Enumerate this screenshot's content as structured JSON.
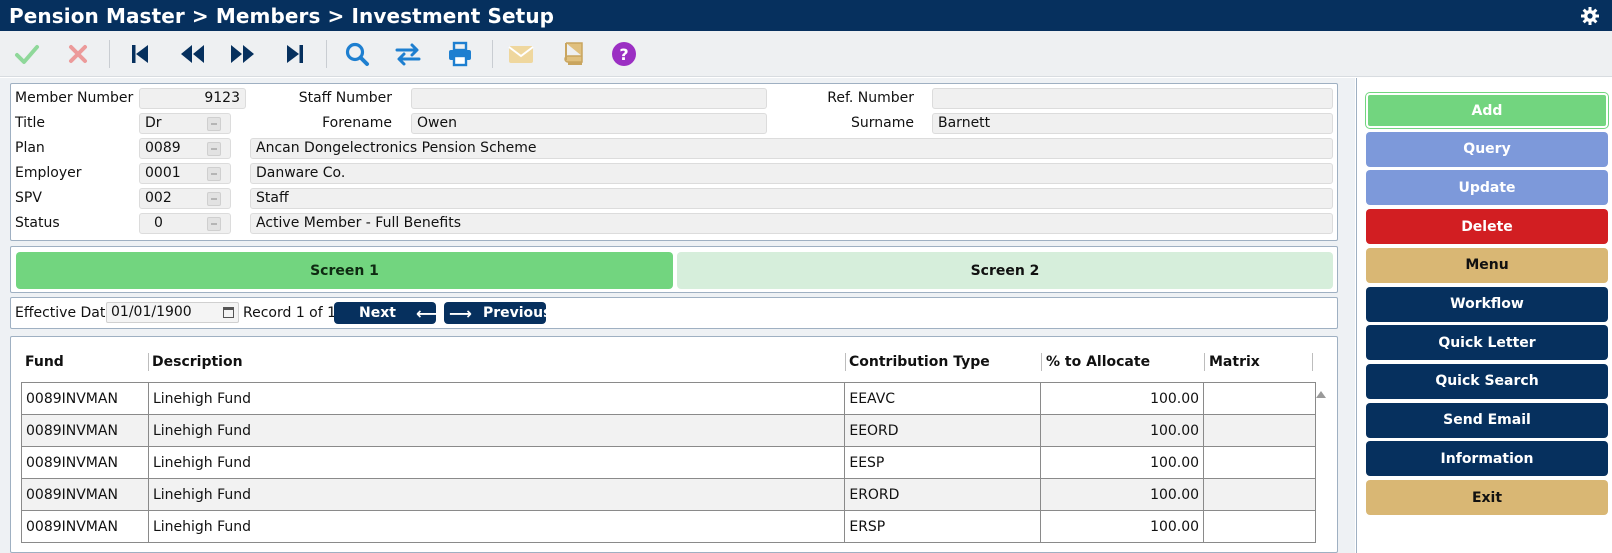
{
  "title": "Pension Master > Members > Investment Setup",
  "toolbar": {
    "icons": [
      "confirm-icon",
      "cancel-icon",
      "first-record-icon",
      "previous-record-icon",
      "next-record-icon",
      "last-record-icon",
      "search-icon",
      "swap-icon",
      "print-icon",
      "mail-icon",
      "book-icon",
      "help-icon"
    ]
  },
  "member": {
    "member_number_label": "Member Number",
    "member_number": "9123",
    "staff_number_label": "Staff Number",
    "staff_number": "",
    "ref_number_label": "Ref. Number",
    "ref_number": "",
    "title_label": "Title",
    "title": "Dr",
    "forename_label": "Forename",
    "forename": "Owen",
    "surname_label": "Surname",
    "surname": "Barnett",
    "plan_label": "Plan",
    "plan_code": "0089",
    "plan_name": "Ancan Dongelectronics Pension Scheme",
    "employer_label": "Employer",
    "employer_code": "0001",
    "employer_name": "Danware Co.",
    "spv_label": "SPV",
    "spv_code": "002",
    "spv_name": "Staff",
    "status_label": "Status",
    "status_code": "0",
    "status_name": "Active Member - Full Benefits"
  },
  "tabs": [
    "Screen 1",
    "Screen 2"
  ],
  "record_nav": {
    "effective_date_label": "Effective Date",
    "effective_date": "01/01/1900",
    "record_text": "Record 1 of 1",
    "next_label": "Next",
    "previous_label": "Previous"
  },
  "grid": {
    "headers": [
      "Fund",
      "Description",
      "Contribution Type",
      "% to Allocate",
      "Matrix"
    ],
    "rows": [
      {
        "fund": "0089INVMAN",
        "description": "Linehigh Fund",
        "type": "EEAVC",
        "pct": "100.00",
        "matrix": ""
      },
      {
        "fund": "0089INVMAN",
        "description": "Linehigh Fund",
        "type": "EEORD",
        "pct": "100.00",
        "matrix": ""
      },
      {
        "fund": "0089INVMAN",
        "description": "Linehigh Fund",
        "type": "EESP",
        "pct": "100.00",
        "matrix": ""
      },
      {
        "fund": "0089INVMAN",
        "description": "Linehigh Fund",
        "type": "ERORD",
        "pct": "100.00",
        "matrix": ""
      },
      {
        "fund": "0089INVMAN",
        "description": "Linehigh Fund",
        "type": "ERSP",
        "pct": "100.00",
        "matrix": ""
      }
    ]
  },
  "actions": [
    {
      "label": "Add",
      "bg": "#72d57f",
      "fg": "#ffffff"
    },
    {
      "label": "Query",
      "bg": "#7d99da",
      "fg": "#ffffff"
    },
    {
      "label": "Update",
      "bg": "#7d99da",
      "fg": "#ffffff"
    },
    {
      "label": "Delete",
      "bg": "#d21e22",
      "fg": "#ffffff"
    },
    {
      "label": "Menu",
      "bg": "#d9b774",
      "fg": "#111111"
    },
    {
      "label": "Workflow",
      "bg": "#06305e",
      "fg": "#ffffff"
    },
    {
      "label": "Quick Letter",
      "bg": "#06305e",
      "fg": "#ffffff"
    },
    {
      "label": "Quick Search",
      "bg": "#06305e",
      "fg": "#ffffff"
    },
    {
      "label": "Send Email",
      "bg": "#06305e",
      "fg": "#ffffff"
    },
    {
      "label": "Information",
      "bg": "#06305e",
      "fg": "#ffffff"
    },
    {
      "label": "Exit",
      "bg": "#d9b774",
      "fg": "#111111"
    }
  ],
  "colors": {
    "header_navy": "#06305e",
    "accent_green": "#72d57f",
    "delete_red": "#d21e22",
    "menu_tan": "#d9b774"
  }
}
